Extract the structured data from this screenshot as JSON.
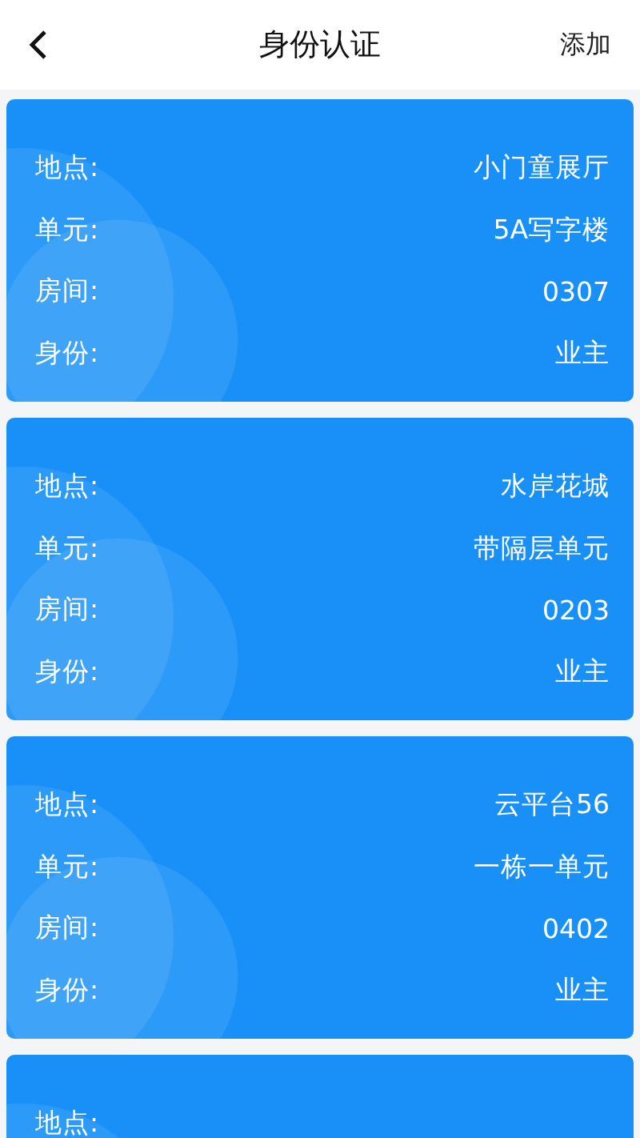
{
  "header": {
    "title": "身份认证",
    "action": "添加"
  },
  "cards": [
    {
      "rows": [
        {
          "label": "地点:",
          "value": "小门童展厅"
        },
        {
          "label": "单元:",
          "value": "5A写字楼"
        },
        {
          "label": "房间:",
          "value": "0307"
        },
        {
          "label": "身份:",
          "value": "业主"
        }
      ]
    },
    {
      "rows": [
        {
          "label": "地点:",
          "value": "水岸花城"
        },
        {
          "label": "单元:",
          "value": "带隔层单元"
        },
        {
          "label": "房间:",
          "value": "0203"
        },
        {
          "label": "身份:",
          "value": "业主"
        }
      ]
    },
    {
      "rows": [
        {
          "label": "地点:",
          "value": "云平台56"
        },
        {
          "label": "单元:",
          "value": "一栋一单元"
        },
        {
          "label": "房间:",
          "value": "0402"
        },
        {
          "label": "身份:",
          "value": "业主"
        }
      ]
    },
    {
      "rows": [
        {
          "label": "地点:"
        }
      ]
    }
  ]
}
